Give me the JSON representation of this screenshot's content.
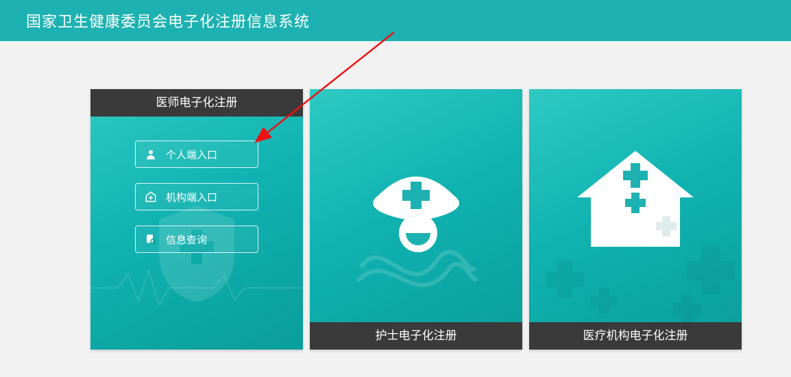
{
  "banner": {
    "title": "国家卫生健康委员会电子化注册信息系统"
  },
  "cards": [
    {
      "title": "医师电子化注册",
      "buttons": [
        {
          "label": "个人端入口",
          "icon": "person-icon"
        },
        {
          "label": "机构端入口",
          "icon": "hospital-cross-icon"
        },
        {
          "label": "信息查询",
          "icon": "search-doc-icon"
        }
      ]
    },
    {
      "title": "护士电子化注册"
    },
    {
      "title": "医疗机构电子化注册"
    }
  ],
  "colors": {
    "brand": "#1db2b1",
    "cardDark": "#3a3a3a",
    "annotation": "#e11"
  }
}
